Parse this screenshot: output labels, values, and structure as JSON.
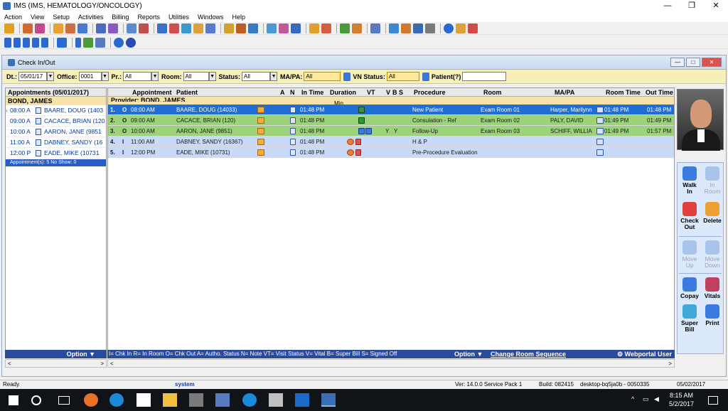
{
  "window": {
    "title": "IMS (IMS, HEMATOLOGY/ONCOLOGY)",
    "min": "—",
    "max": "❐",
    "close": "✕"
  },
  "menu": [
    "Action",
    "View",
    "Setup",
    "Activities",
    "Billing",
    "Reports",
    "Utilities",
    "Windows",
    "Help"
  ],
  "inner": {
    "title": "Check In/Out",
    "min": "—",
    "max": "□",
    "close": "✕"
  },
  "filter": {
    "dt_label": "Dt.:",
    "dt_value": "05/01/17",
    "office_label": "Office:",
    "office_value": "0001",
    "pr_label": "Pr.:",
    "pr_value": "All",
    "room_label": "Room:",
    "room_value": "All",
    "status_label": "Status:",
    "status_value": "All",
    "mapa_label": "MA/PA:",
    "mapa_value": "All",
    "vn_label": "VN Status:",
    "vn_value": "All",
    "patient_label": "Patient(?)",
    "patient_value": ""
  },
  "left": {
    "header": "Appointments (05/01/2017)",
    "provider": "BOND, JAMES",
    "rows": [
      {
        "time": "08:00 A",
        "name": "BAARE, DOUG  (1403"
      },
      {
        "time": "09:00 A",
        "name": "CACACE, BRIAN  (120"
      },
      {
        "time": "10:00 A",
        "name": "AARON, JANE  (9851"
      },
      {
        "time": "11:00 A",
        "name": "DABNEY, SANDY  (16"
      },
      {
        "time": "12:00 P",
        "name": "EADE, MIKE  (10731"
      }
    ],
    "summary": "Appointment(s): 5    No Show: 0",
    "option": "Option ▼"
  },
  "grid": {
    "headers": {
      "appointment": "Appointment",
      "patient": "Patient",
      "a": "A",
      "n": "N",
      "in_time": "In Time",
      "duration": "Duration",
      "vt": "VT",
      "v": "V",
      "b": "B",
      "s": "S",
      "procedure": "Procedure",
      "room": "Room",
      "mapa": "MA/PA",
      "room_time": "Room Time",
      "out_time": "Out Time"
    },
    "provider": "Provider: BOND, JAMES",
    "min_label": "Min.",
    "rows": [
      {
        "num": "1.",
        "st": "O",
        "appt": "08:00 AM",
        "patient": "BAARE, DOUG  (14033)",
        "in_time": "01:48 PM",
        "v": "",
        "b": "",
        "procedure": "New Patient",
        "room": "Exam Room 01",
        "mapa": "Harper, Marilynn",
        "room_time": "01:48 PM",
        "out_time": "01:48 PM"
      },
      {
        "num": "2.",
        "st": "O",
        "appt": "09:00 AM",
        "patient": "CACACE, BRIAN  (120)",
        "in_time": "01:48 PM",
        "v": "",
        "b": "",
        "procedure": "Consulation - Ref",
        "room": "Exam Room 02",
        "mapa": "PALY, DAVID",
        "room_time": "01:49 PM",
        "out_time": "01:49 PM"
      },
      {
        "num": "3.",
        "st": "O",
        "appt": "10:00 AM",
        "patient": "AARON, JANE  (9851)",
        "in_time": "01:48 PM",
        "v": "Y",
        "b": "Y",
        "procedure": "Follow-Up",
        "room": "Exam Room 03",
        "mapa": "SCHIFF, WILLIA",
        "room_time": "01:49 PM",
        "out_time": "01:57 PM"
      },
      {
        "num": "4.",
        "st": "I",
        "appt": "11:00 AM",
        "patient": "DABNEY, SANDY  (16367)",
        "in_time": "01:48 PM",
        "v": "",
        "b": "",
        "procedure": "H & P",
        "room": "",
        "mapa": "",
        "room_time": "",
        "out_time": ""
      },
      {
        "num": "5.",
        "st": "I",
        "appt": "12:00 PM",
        "patient": "EADE, MIKE  (10731)",
        "in_time": "01:48 PM",
        "v": "",
        "b": "",
        "procedure": "Pre-Procedure Evaluation",
        "room": "",
        "mapa": "",
        "room_time": "",
        "out_time": ""
      }
    ],
    "legend": "I= Chk In  R= In Room O= Chk Out  A= Autho. Status  N= Note  VT= Visit Status  V= Vital  B= Super Bill  S= Signed Off",
    "option": "Option ▼",
    "change_room": "Change Room Sequence",
    "webportal": "⚙ Webportal User"
  },
  "actions": {
    "walkin": [
      "Walk",
      "In"
    ],
    "in_room": [
      "In",
      "Room"
    ],
    "checkout": [
      "Check",
      "Out"
    ],
    "delete": "Delete",
    "moveup": [
      "Move",
      "Up"
    ],
    "movedown": [
      "Move",
      "Down"
    ],
    "copay": "Copay",
    "vitals": "Vitals",
    "superbill": [
      "Super",
      "Bill"
    ],
    "print": "Print"
  },
  "status": {
    "ready": "Ready",
    "user": "system",
    "version": "Ver: 14.0.0 Service Pack 1",
    "build": "Build: 082415",
    "machine": "desktop-bq5ja0b - 0050335",
    "date": "05/02/2017"
  },
  "taskbar": {
    "time": "8:15 AM",
    "date": "5/2/2017"
  },
  "colors": {
    "selected_row": "#1e6ed6",
    "checked_out_row": "#9bd27a",
    "checked_in_row": "#c8daf7",
    "filter_bar": "#f6f0b8",
    "provider_bar": "#f6e3a8"
  }
}
